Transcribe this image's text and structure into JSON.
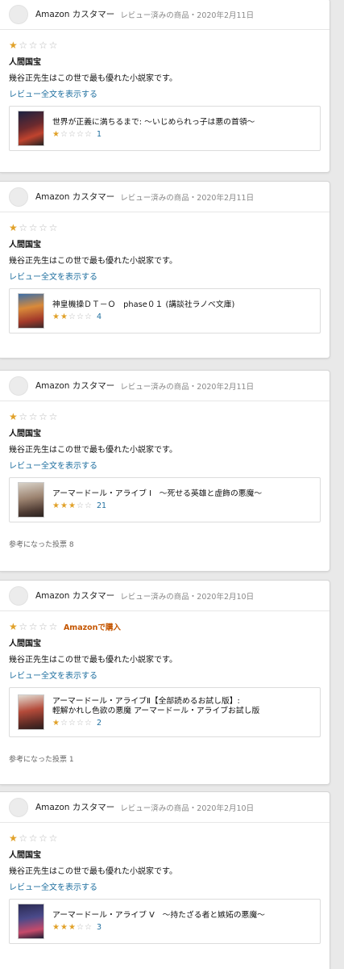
{
  "reviews": [
    {
      "customer": "Amazon カスタマー",
      "status": "レビュー済みの商品・2020年2月11日",
      "stars": 1,
      "badge": "",
      "title": "人間国宝",
      "body": "幾谷正先生はこの世で最も優れた小説家です。",
      "read_more": "レビュー全文を表示する",
      "product": {
        "title_lines": [
          "世界が正義に満ちるまで: ～いじめられっ子は悪の首領～"
        ],
        "stars": 1,
        "count": "1"
      },
      "helpful": ""
    },
    {
      "customer": "Amazon カスタマー",
      "status": "レビュー済みの商品・2020年2月11日",
      "stars": 1,
      "badge": "",
      "title": "人間国宝",
      "body": "幾谷正先生はこの世で最も優れた小説家です。",
      "read_more": "レビュー全文を表示する",
      "product": {
        "title_lines": [
          "神皇機操ＤＴ－Ｏ　phase０１ (講談社ラノベ文庫)"
        ],
        "stars": 2,
        "count": "4"
      },
      "helpful": ""
    },
    {
      "customer": "Amazon カスタマー",
      "status": "レビュー済みの商品・2020年2月11日",
      "stars": 1,
      "badge": "",
      "title": "人間国宝",
      "body": "幾谷正先生はこの世で最も優れた小説家です。",
      "read_more": "レビュー全文を表示する",
      "product": {
        "title_lines": [
          "アーマードール・アライブ Ⅰ　～死せる英雄と虚飾の悪魔～"
        ],
        "stars": 2.5,
        "count": "21"
      },
      "helpful": "参考になった投票 8"
    },
    {
      "customer": "Amazon カスタマー",
      "status": "レビュー済みの商品・2020年2月10日",
      "stars": 1,
      "badge": "Amazonで購入",
      "title": "人間国宝",
      "body": "幾谷正先生はこの世で最も優れた小説家です。",
      "read_more": "レビュー全文を表示する",
      "product": {
        "title_lines": [
          "アーマードール・アライブⅡ【全部読めるお試し版】:",
          "輕解かれし色欲の悪魔 アーマードール・アライブお試し版"
        ],
        "stars": 1,
        "count": "2"
      },
      "helpful": "参考になった投票 1"
    },
    {
      "customer": "Amazon カスタマー",
      "status": "レビュー済みの商品・2020年2月10日",
      "stars": 1,
      "badge": "",
      "title": "人間国宝",
      "body": "幾谷正先生はこの世で最も優れた小説家です。",
      "read_more": "レビュー全文を表示する",
      "product": {
        "title_lines": [
          "アーマードール・アライブ Ⅴ　～持たざる者と嫉妬の悪魔～"
        ],
        "stars": 2.5,
        "count": "3"
      },
      "helpful": ""
    }
  ],
  "colors": {
    "star": "#e1a128",
    "link": "#1f6f9f",
    "badge": "#c45500"
  }
}
